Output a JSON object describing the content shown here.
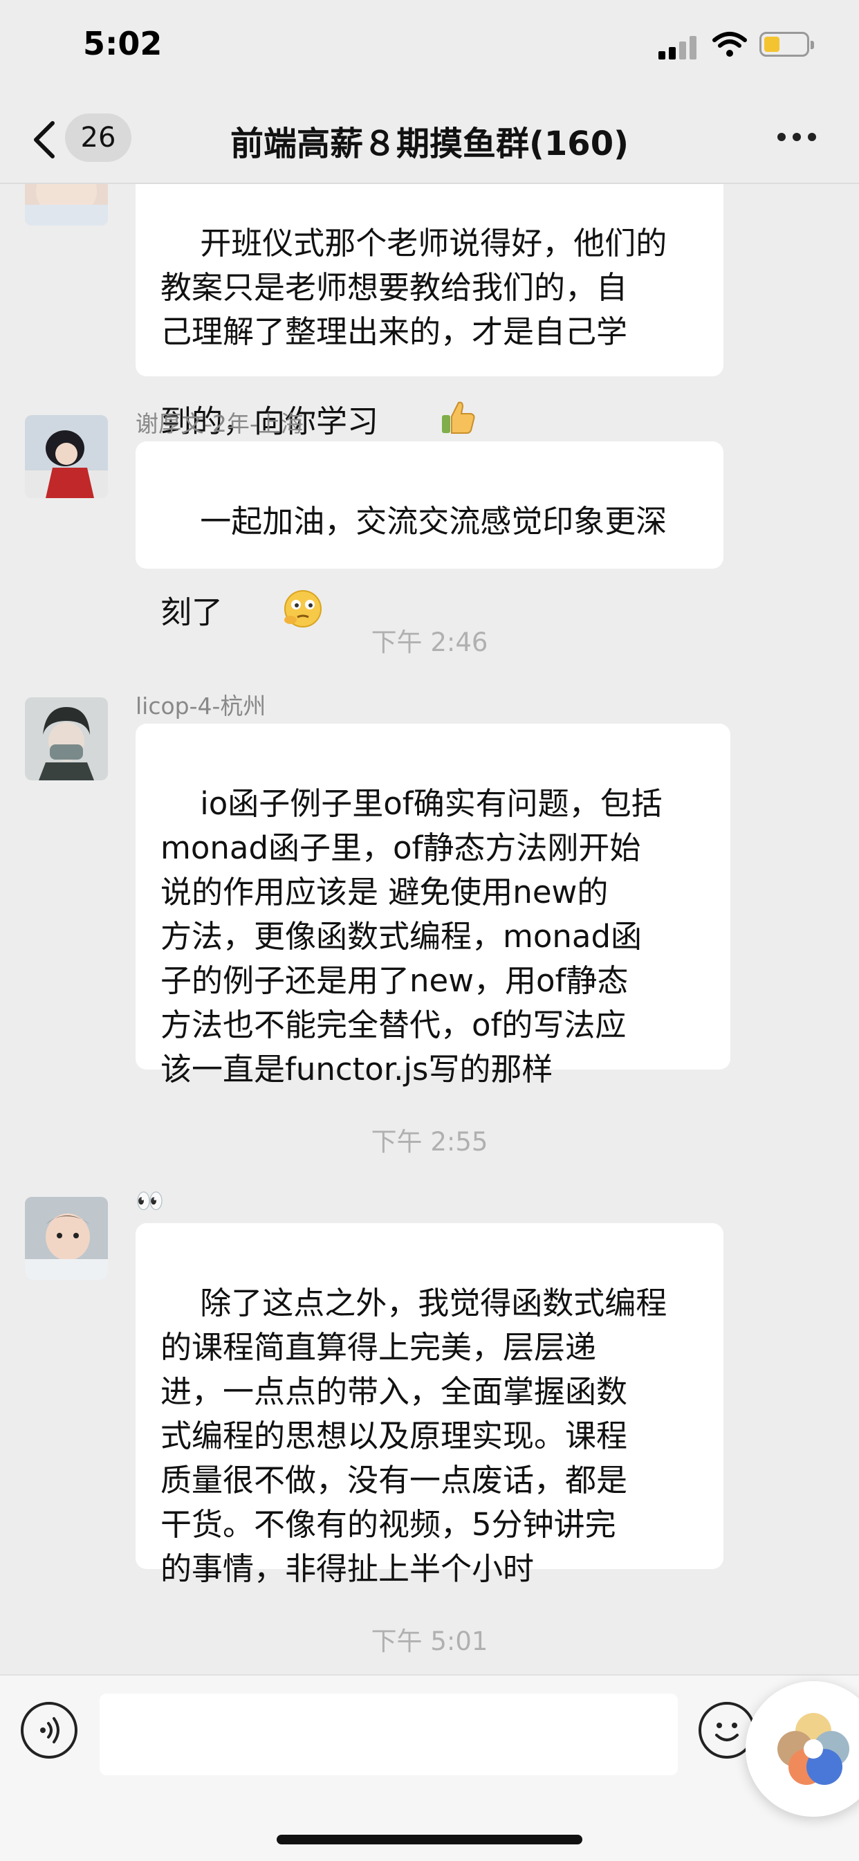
{
  "status_bar": {
    "time": "5:02"
  },
  "nav": {
    "unread_count": "26",
    "title": "前端高薪８期摸鱼群(160)"
  },
  "messages": [
    {
      "sender": "",
      "text": "开班仪式那个老师说得好，他们的\n教案只是老师想要教给我们的，自\n己理解了整理出来的，才是自己学\n到的，向你学习",
      "trailing_emoji": "thumbs-up"
    },
    {
      "sender": "谢厚文-2年-上海",
      "text": "一起加油，交流交流感觉印象更深\n刻了",
      "trailing_emoji": "thinking-face"
    },
    {
      "sender": "licop-4-杭州",
      "text": "io函子例子里of确实有问题，包括\nmonad函子里，of静态方法刚开始\n说的作用应该是 避免使用new的\n方法，更像函数式编程，monad函\n子的例子还是用了new，用of静态\n方法也不能完全替代，of的写法应\n该一直是functor.js写的那样"
    },
    {
      "sender": "👀",
      "text": "除了这点之外，我觉得函数式编程\n的课程简直算得上完美，层层递\n进，一点点的带入，全面掌握函数\n式编程的思想以及原理实现。课程\n质量很不做，没有一点废话，都是\n干货。不像有的视频，5分钟讲完\n的事情，非得扯上半个小时"
    }
  ],
  "timestamps": [
    "下午 2:46",
    "下午 2:55",
    "下午 5:01"
  ],
  "input_bar": {
    "placeholder": ""
  },
  "icons": {
    "back": "chevron-left-icon",
    "more": "more-dots-icon",
    "voice": "voice-icon",
    "emoji": "emoji-icon"
  },
  "colors": {
    "background": "#ededed",
    "bubble": "#ffffff",
    "timestamp": "#b0b0b0",
    "sender": "#888888",
    "battery": "#f4c430"
  }
}
